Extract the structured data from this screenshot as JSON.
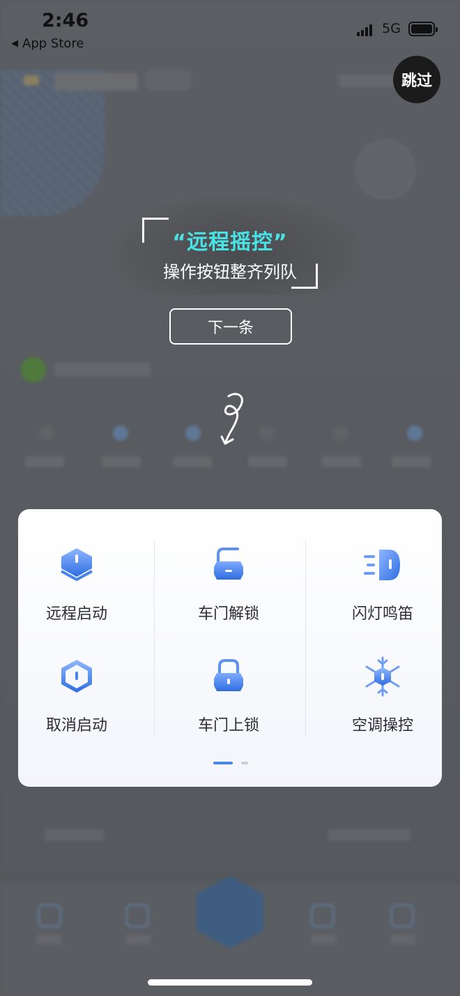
{
  "status_bar": {
    "time": "2:46",
    "back_app": "App Store",
    "network": "5G"
  },
  "skip_button": {
    "label": "跳过"
  },
  "guide": {
    "title": "“远程摇控”",
    "subtitle": "操作按钮整齐列队",
    "next_label": "下一条"
  },
  "controls": [
    {
      "label": "远程启动",
      "icon": "remote-start-icon"
    },
    {
      "label": "车门解锁",
      "icon": "door-unlock-icon"
    },
    {
      "label": "闪灯鸣笛",
      "icon": "flash-horn-icon"
    },
    {
      "label": "取消启动",
      "icon": "cancel-start-icon"
    },
    {
      "label": "车门上锁",
      "icon": "door-lock-icon"
    },
    {
      "label": "空调操控",
      "icon": "ac-control-icon"
    }
  ],
  "pager": {
    "current": 1,
    "total": 2
  },
  "colors": {
    "accent_teal": "#49e3e6",
    "icon_blue": "#3a78e6",
    "overlay": "#585a5d"
  }
}
